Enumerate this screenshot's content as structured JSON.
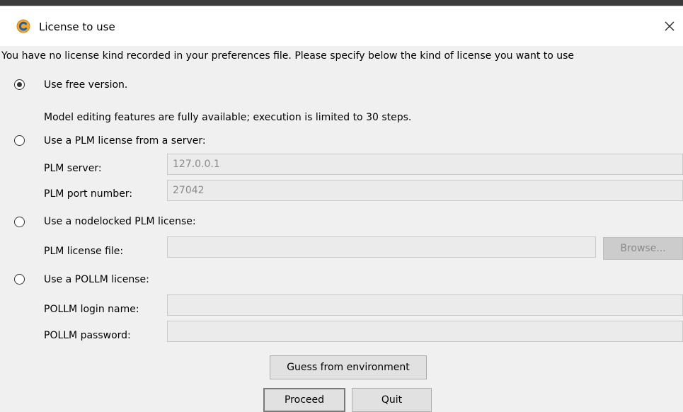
{
  "window": {
    "title": "License to use",
    "icon": "app-logo-icon",
    "close_glyph": "✕"
  },
  "intro_text": "You have no license kind recorded in your preferences file. Please specify below the kind of license you want to use",
  "options": {
    "free": {
      "label": "Use free version.",
      "description": "Model editing features are fully available; execution is limited to 30 steps.",
      "selected": true
    },
    "plm_server": {
      "label": "Use a PLM license from a server:",
      "selected": false,
      "server_label": "PLM server:",
      "server_value": "127.0.0.1",
      "port_label": "PLM port number:",
      "port_value": "27042"
    },
    "nodelocked": {
      "label": "Use a nodelocked PLM license:",
      "selected": false,
      "file_label": "PLM license file:",
      "file_value": "",
      "browse_label": "Browse..."
    },
    "pollm": {
      "label": "Use a POLLM license:",
      "selected": false,
      "login_label": "POLLM login name:",
      "login_value": "",
      "password_label": "POLLM password:",
      "password_value": ""
    }
  },
  "buttons": {
    "guess": "Guess from environment",
    "proceed": "Proceed",
    "quit": "Quit"
  },
  "colors": {
    "dialog_background": "#f0f0f0",
    "titlebar_background": "#ffffff",
    "disabled_field": "#ebebeb",
    "disabled_text": "#8a8a8a",
    "button_face": "#e1e1e1",
    "icon_orange": "#f5a623",
    "icon_blue": "#1e5fb4"
  }
}
